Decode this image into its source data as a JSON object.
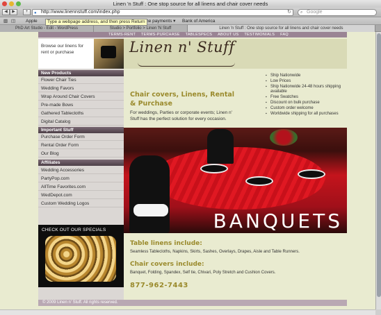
{
  "browser": {
    "window_title": "Linen 'n Stuff : One stop source for all linens and chair cover needs",
    "url": "http://www.linennstuff.com/index.php",
    "search_placeholder": "Google",
    "tooltip": "Type a webpage address, and then press Return",
    "bookmarks": [
      "Apple",
      "online payments ▾",
      "Bank of America"
    ],
    "tabs": [
      {
        "label": "PhD Art Studio - Edit - WordPress"
      },
      {
        "label": "Studio > Portfolio > Linen 'N Stuff"
      },
      {
        "label": "Linen 'n Stuff : One stop source for all linens and chair cover needs"
      }
    ]
  },
  "topnav": [
    "TERMS-RENT",
    "TERMS-PURCHASE",
    "TABLESPECS",
    "ABOUT US",
    "TESTIMONIALS",
    "FAQ"
  ],
  "sidebar": {
    "browse_text": "Browse our linens for rent or purchase",
    "sections": [
      {
        "heading": "New Products",
        "items": [
          "Flower Chair Ties",
          "Wedding Favors",
          "Wrap Around Chair Covers",
          "Pre-made Bows",
          "Gathered Tablecloths",
          "Digital Catalog"
        ]
      },
      {
        "heading": "Important Stuff",
        "items": [
          "Purchase Order Form",
          "Rental Order Form",
          "Our Blog"
        ]
      },
      {
        "heading": "Affiliates",
        "items": [
          "Wedding Accessories",
          "PartyPop.com",
          "AllTime Favorites.com",
          "WedDepot.com",
          "Custom Wedding Logos"
        ]
      }
    ],
    "specials_label": "CHECK OUT OUR SPECIALS"
  },
  "main": {
    "logo": "Linen n' Stuff",
    "headline": "Chair covers, Linens, Rental & Purchase",
    "intro": "For weddings, Parties or corporate events; Linen n' Stuff has the perfect solution for every occasion.",
    "features": [
      "Ship Nationwide",
      "Low Prices",
      "Ship Nationwide 24-48 hours shipping available",
      "Free Swatches",
      "Discount on bulk purchase",
      "Custom order welcome",
      "Worldwide shipping for all purchases"
    ],
    "hero_caption": "BANQUETS",
    "table_linens_heading": "Table linens include:",
    "table_linens_text": "Seamless Tablecloths, Napkins, Skirts, Sashes, Overlays, Drapes, Aisle and Table Runners.",
    "chair_covers_heading": "Chair covers include:",
    "chair_covers_text": "Banquet, Folding, Spandex, Self tie, Chivari, Poly Stretch and Cushion Covers.",
    "phone": "877-962-7443"
  },
  "footer": "© 2009 Linen n' Stuff. All rights reserved.",
  "colors": {
    "page_bg": "#e9ebd0",
    "nav_bar": "#9a8494",
    "menu_header": "#4d3f47",
    "heading_gold": "#9a8a2c",
    "footer_bg": "#b9a8b3"
  }
}
